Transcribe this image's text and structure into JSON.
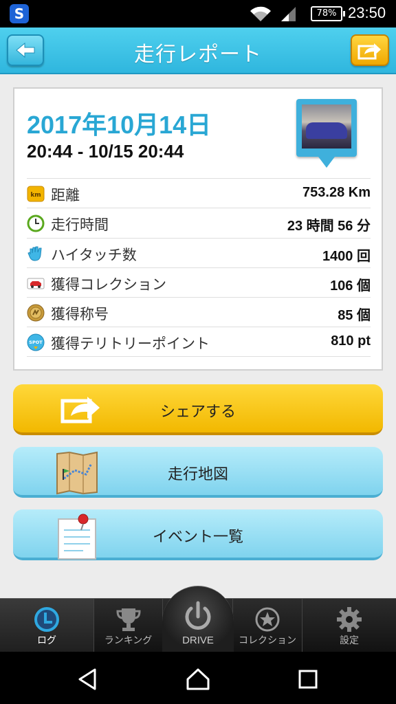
{
  "status_bar": {
    "battery": "78%",
    "time": "23:50",
    "app_icon_letter": "S"
  },
  "header": {
    "title": "走行レポート"
  },
  "report": {
    "date": "2017年10月14日",
    "range": "20:44 - 10/15 20:44",
    "stats": [
      {
        "icon": "km-icon",
        "label": "距離",
        "value": "753.28 Km"
      },
      {
        "icon": "clock-icon",
        "label": "走行時間",
        "value": "23 時間 56 分"
      },
      {
        "icon": "hand-icon",
        "label": "ハイタッチ数",
        "value": "1400 回"
      },
      {
        "icon": "car-icon",
        "label": "獲得コレクション",
        "value": "106 個"
      },
      {
        "icon": "medal-icon",
        "label": "獲得称号",
        "value": "85 個"
      },
      {
        "icon": "spot-icon",
        "label": "獲得テリトリーポイント",
        "value": "810 pt"
      }
    ]
  },
  "actions": {
    "share": "シェアする",
    "map": "走行地図",
    "events": "イベント一覧"
  },
  "tabs": {
    "log": "ログ",
    "ranking": "ランキング",
    "drive": "DRIVE",
    "collection": "コレクション",
    "settings": "設定"
  },
  "colors": {
    "accent": "#29a7d4",
    "header": "#3ec2e8",
    "share_button": "#f5c400"
  }
}
